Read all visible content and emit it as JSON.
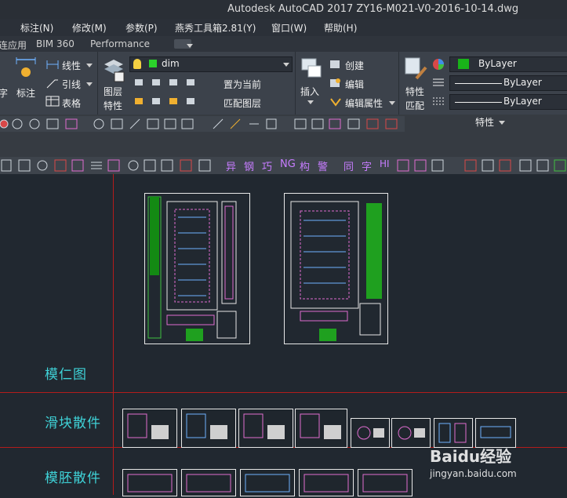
{
  "window": {
    "title": "Autodesk AutoCAD 2017    ZY16-M021-V0-2016-10-14.dwg"
  },
  "menu": [
    "标注(N)",
    "修改(M)",
    "参数(P)",
    "燕秀工具箱2.81(Y)",
    "窗口(W)",
    "帮助(H)"
  ],
  "tabs": [
    "连应用",
    "BIM 360",
    "Performance"
  ],
  "ribbon": {
    "dim_group": {
      "label": "标注",
      "left_label": "字"
    },
    "linetype_label": "线性",
    "leader_label": "引线",
    "table_label": "表格",
    "layer_props_label1": "图层",
    "layer_props_label2": "特性",
    "layer_combo_value": "dim",
    "set_current_label": "置为当前",
    "match_layer_label": "匹配图层",
    "insert_label": "插入",
    "create_label": "创建",
    "edit_label": "编辑",
    "edit_attr_label": "编辑属性",
    "match_props_label1": "特性",
    "match_props_label2": "匹配",
    "color_combo_value": "ByLayer",
    "linetype_combo_value": "ByLayer",
    "lineweight_combo_value": "ByLayer",
    "properties_panel_label": "特性"
  },
  "custom_toolbar": [
    "异",
    "钢",
    "巧",
    "NG",
    "构",
    "警",
    "同",
    "字",
    "HI"
  ],
  "drawing": {
    "labels": [
      "模仁图",
      "滑块散件",
      "模胚散件"
    ]
  },
  "watermark": {
    "brand": "Baidu经验",
    "url": "jingyan.baidu.com"
  }
}
